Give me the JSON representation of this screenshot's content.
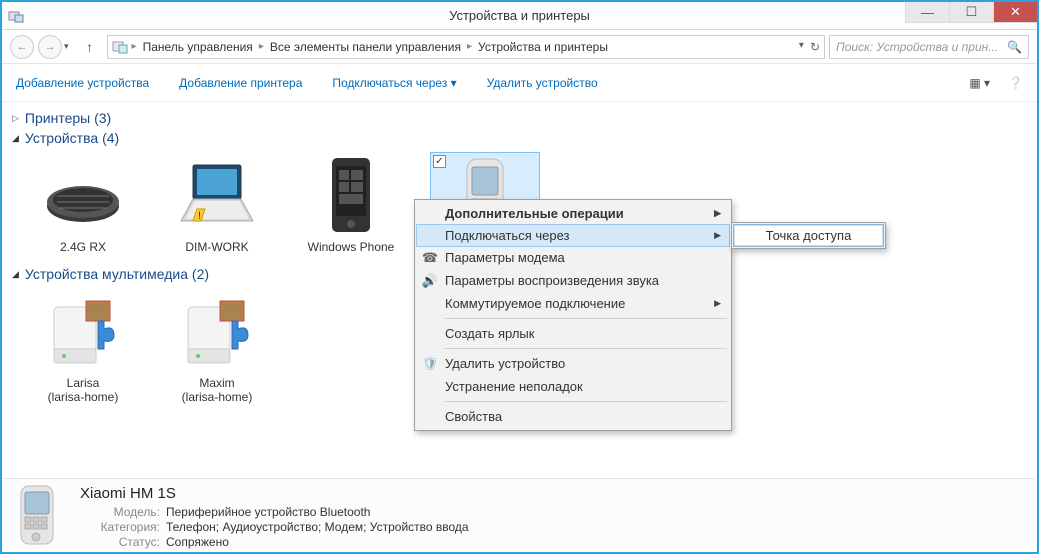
{
  "window": {
    "title": "Устройства и принтеры"
  },
  "breadcrumbs": {
    "b1": "Панель управления",
    "b2": "Все элементы панели управления",
    "b3": "Устройства и принтеры"
  },
  "search": {
    "placeholder": "Поиск: Устройства и прин..."
  },
  "toolbar": {
    "add_device": "Добавление устройства",
    "add_printer": "Добавление принтера",
    "connect_via": "Подключаться через",
    "remove_device": "Удалить устройство"
  },
  "groups": {
    "printers": {
      "label": "Принтеры",
      "count": "(3)"
    },
    "devices": {
      "label": "Устройства",
      "count": "(4)"
    },
    "multimedia": {
      "label": "Устройства мультимедиа",
      "count": "(2)"
    }
  },
  "devices": {
    "d1": "2.4G RX",
    "d2": "DIM-WORK",
    "d3": "Windows Phone",
    "d4": "Xiaomi"
  },
  "media": {
    "m1": {
      "name": "Larisa",
      "host": "(larisa-home)"
    },
    "m2": {
      "name": "Maxim",
      "host": "(larisa-home)"
    }
  },
  "context": {
    "additional": "Дополнительные операции",
    "connect_via": "Подключаться через",
    "modem_params": "Параметры модема",
    "sound_params": "Параметры воспроизведения звука",
    "dialup": "Коммутируемое подключение",
    "shortcut": "Создать ярлык",
    "remove": "Удалить устройство",
    "troubleshoot": "Устранение неполадок",
    "properties": "Свойства"
  },
  "submenu": {
    "access_point": "Точка доступа"
  },
  "details": {
    "name": "Xiaomi HM 1S",
    "label_model": "Модель:",
    "model": "Периферийное устройство Bluetooth",
    "label_category": "Категория:",
    "category": "Телефон; Аудиоустройство; Модем; Устройство ввода",
    "label_status": "Статус:",
    "status": "Сопряжено"
  }
}
